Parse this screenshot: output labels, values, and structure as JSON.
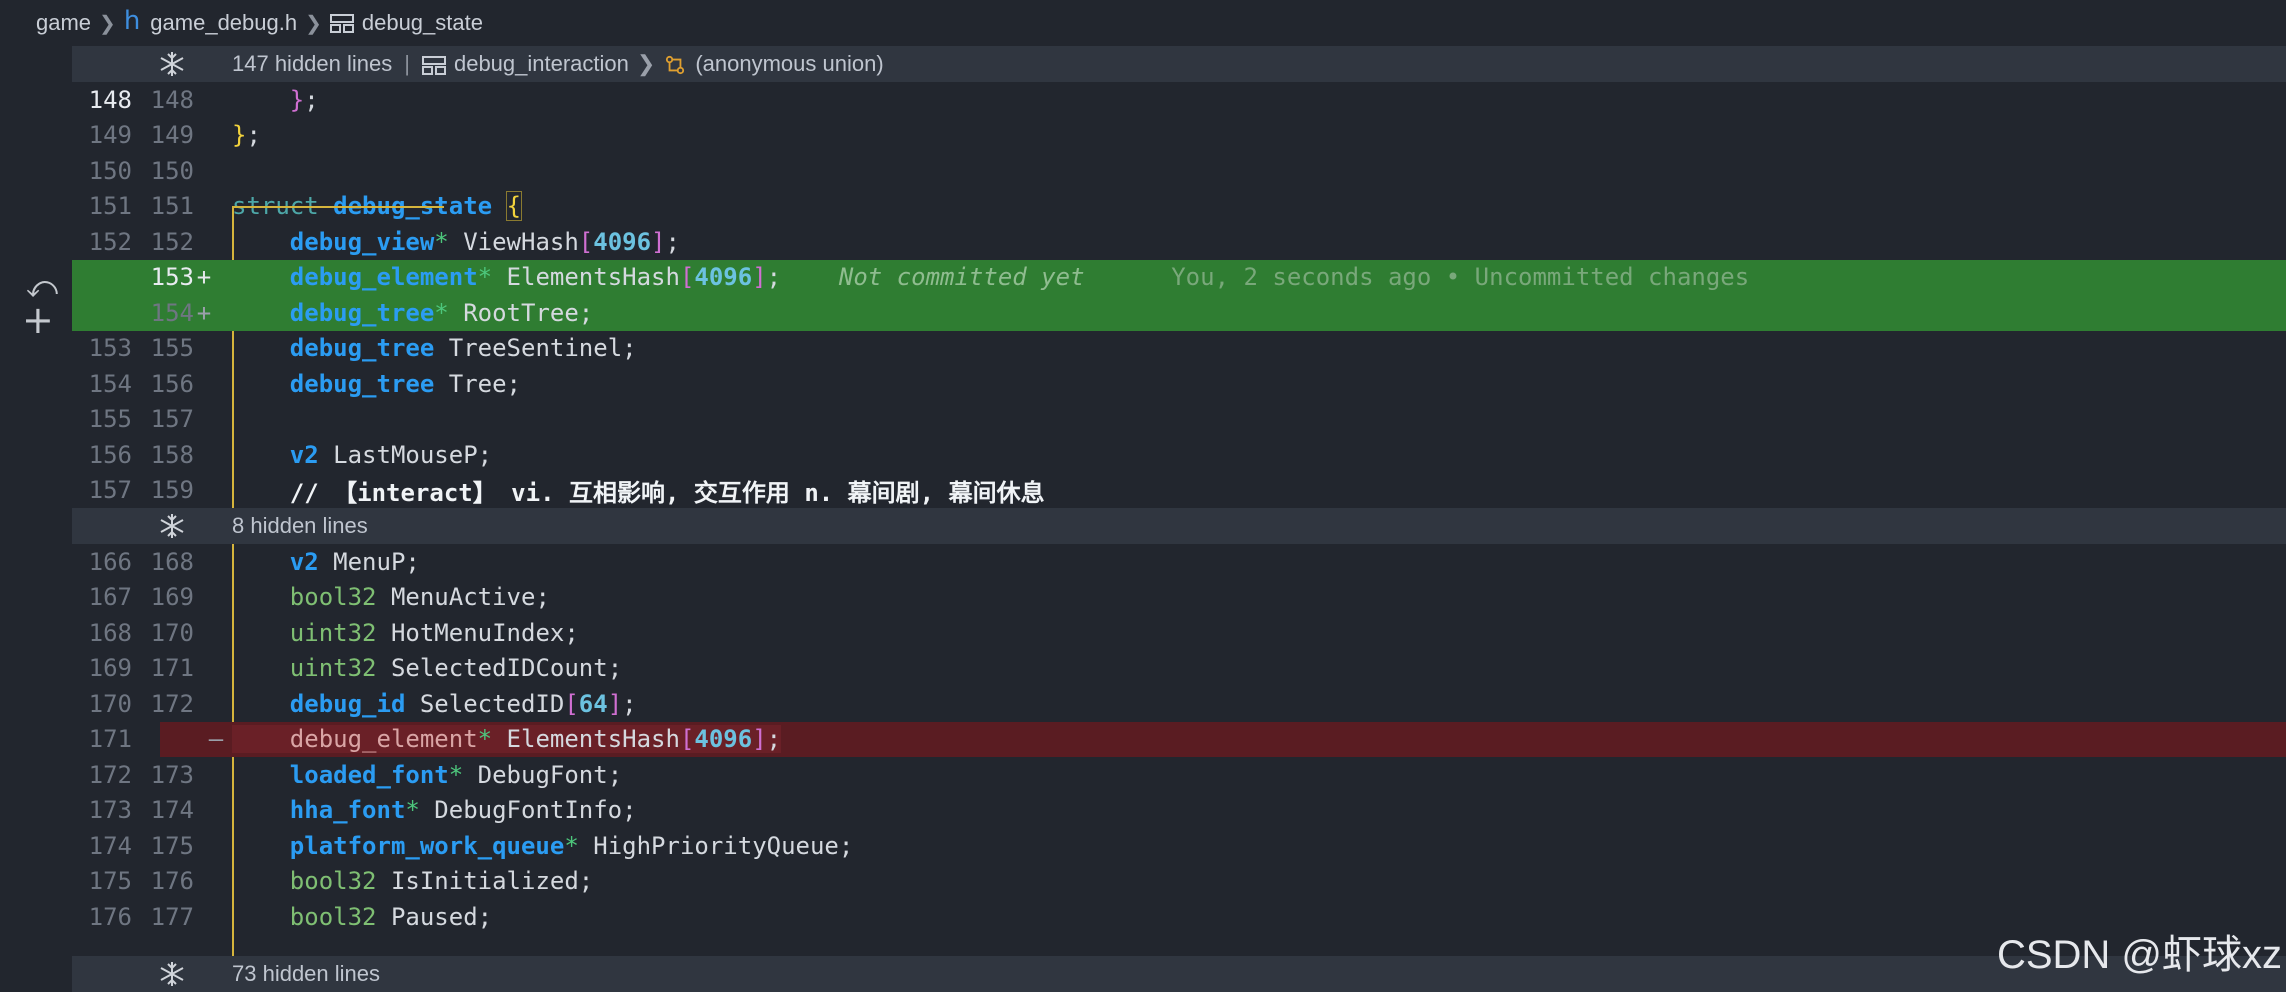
{
  "breadcrumb": {
    "folder": "game",
    "file_icon": "h",
    "file": "game_debug.h",
    "symbol": "debug_state"
  },
  "folds": [
    {
      "hidden": "147 hidden lines",
      "sep": "|",
      "ctx1": "debug_interaction",
      "ctx2": "(anonymous union)"
    },
    {
      "hidden": "8 hidden lines"
    },
    {
      "hidden": "73 hidden lines"
    }
  ],
  "lines": [
    {
      "a": "148",
      "b": "148"
    },
    {
      "a": "149",
      "b": "149"
    },
    {
      "a": "150",
      "b": "150"
    },
    {
      "a": "151",
      "b": "151"
    },
    {
      "a": "152",
      "b": "152"
    },
    {
      "a": "",
      "b": "153",
      "mark": "+"
    },
    {
      "a": "",
      "b": "154",
      "mark": "+"
    },
    {
      "a": "153",
      "b": "155"
    },
    {
      "a": "154",
      "b": "156"
    },
    {
      "a": "155",
      "b": "157"
    },
    {
      "a": "156",
      "b": "158"
    },
    {
      "a": "157",
      "b": "159"
    },
    {
      "a": "166",
      "b": "168"
    },
    {
      "a": "167",
      "b": "169"
    },
    {
      "a": "168",
      "b": "170"
    },
    {
      "a": "169",
      "b": "171"
    },
    {
      "a": "170",
      "b": "172"
    },
    {
      "a": "171",
      "b": "",
      "mark": "—"
    },
    {
      "a": "172",
      "b": "173"
    },
    {
      "a": "173",
      "b": "174"
    },
    {
      "a": "174",
      "b": "175"
    },
    {
      "a": "175",
      "b": "176"
    },
    {
      "a": "176",
      "b": "177"
    }
  ],
  "code": {
    "l148": "};",
    "l149": "};",
    "struct_kw": "struct",
    "struct_name": "debug_state",
    "open_brace": "{",
    "view_type": "debug_view",
    "view_field": " ViewHash",
    "n4096": "4096",
    "el_type": "debug_element",
    "el_field": " ElementsHash",
    "blame_inline": "Not committed yet",
    "blame_hover": "You, 2 seconds ago • Uncommitted changes",
    "tree_type": "debug_tree",
    "tree_field_ptr": " RootTree;",
    "tree_field1": " TreeSentinel;",
    "tree_field2": " Tree;",
    "v2": "v2",
    "lastmouse": " LastMouseP;",
    "comment": "// 【interact】 vi. 互相影响, 交互作用 n. 幕间剧, 幕间休息",
    "menup": " MenuP;",
    "bool32": "bool32",
    "uint32": "uint32",
    "menuactive": " MenuActive;",
    "hotmenu": " HotMenuIndex;",
    "selcount": " SelectedIDCount;",
    "debug_id": "debug_id",
    "selid": " SelectedID",
    "n64": "64",
    "loaded_font": "loaded_font",
    "debugfont": " DebugFont;",
    "hha_font": "hha_font",
    "debugfontinfo": " DebugFontInfo;",
    "pwq": "platform_work_queue",
    "hpq": " HighPriorityQueue;",
    "isinit": " IsInitialized;",
    "paused": " Paused;"
  },
  "gutter_icons": [
    "revert-icon",
    "add-icon"
  ],
  "watermark": "CSDN @虾球xz",
  "colors": {
    "added_bg": "#2f7d32",
    "removed_bg": "#5a1c22",
    "type": "#2b9cf2",
    "number": "#6cc2e0"
  }
}
